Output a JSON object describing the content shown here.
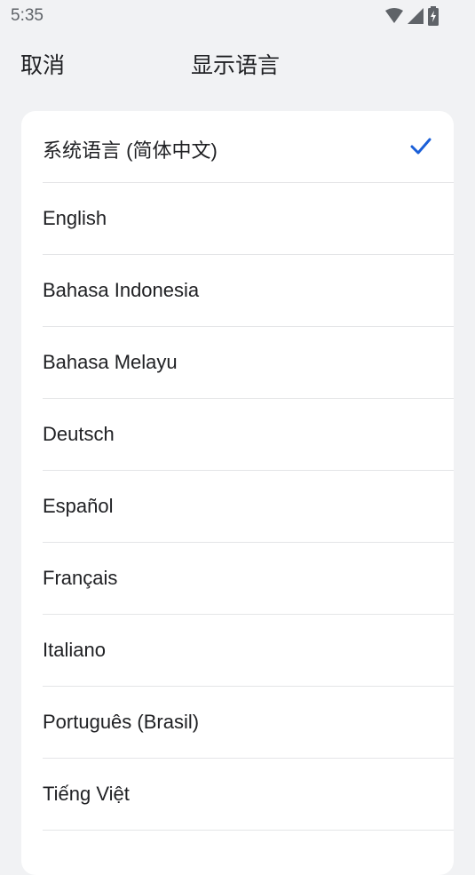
{
  "status_bar": {
    "time": "5:35",
    "icons": [
      "wifi-icon",
      "cell-signal-icon",
      "battery-charging-icon"
    ]
  },
  "header": {
    "cancel_label": "取消",
    "title": "显示语言"
  },
  "colors": {
    "background": "#f1f2f4",
    "card": "#ffffff",
    "accent": "#1a5fd8",
    "divider": "#e4e5e7",
    "text": "#202124"
  },
  "languages": [
    {
      "label": "系统语言 (简体中文)",
      "selected": true
    },
    {
      "label": "English",
      "selected": false
    },
    {
      "label": "Bahasa Indonesia",
      "selected": false
    },
    {
      "label": "Bahasa Melayu",
      "selected": false
    },
    {
      "label": "Deutsch",
      "selected": false
    },
    {
      "label": "Español",
      "selected": false
    },
    {
      "label": "Français",
      "selected": false
    },
    {
      "label": "Italiano",
      "selected": false
    },
    {
      "label": "Português (Brasil)",
      "selected": false
    },
    {
      "label": "Tiếng Việt",
      "selected": false
    }
  ]
}
